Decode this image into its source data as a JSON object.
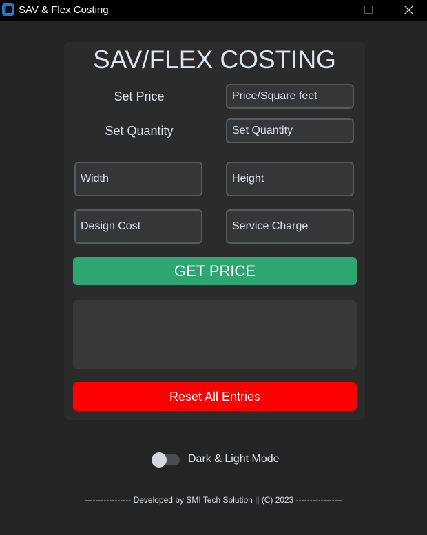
{
  "window": {
    "title": "SAV & Flex Costing",
    "icon": "app-icon"
  },
  "heading": "SAV/FLEX COSTING",
  "form": {
    "set_price_label": "Set Price",
    "set_price_placeholder": "Price/Square feet",
    "set_quantity_label": "Set Quantity",
    "set_quantity_placeholder": "Set Quantity",
    "width_placeholder": "Width",
    "height_placeholder": "Height",
    "design_cost_placeholder": "Design Cost",
    "service_charge_placeholder": "Service Charge"
  },
  "buttons": {
    "get_price": "GET PRICE",
    "reset": "Reset All Entries"
  },
  "result": "",
  "appearance": {
    "switch_label": "Dark & Light Mode",
    "switch_on": false
  },
  "footer": "----------------- Developed by SMI Tech Solution || (C) 2023 -----------------",
  "colors": {
    "background": "#242424",
    "panel": "#2b2b2b",
    "primary_button": "#2fa572",
    "reset_button": "#ff0000"
  }
}
